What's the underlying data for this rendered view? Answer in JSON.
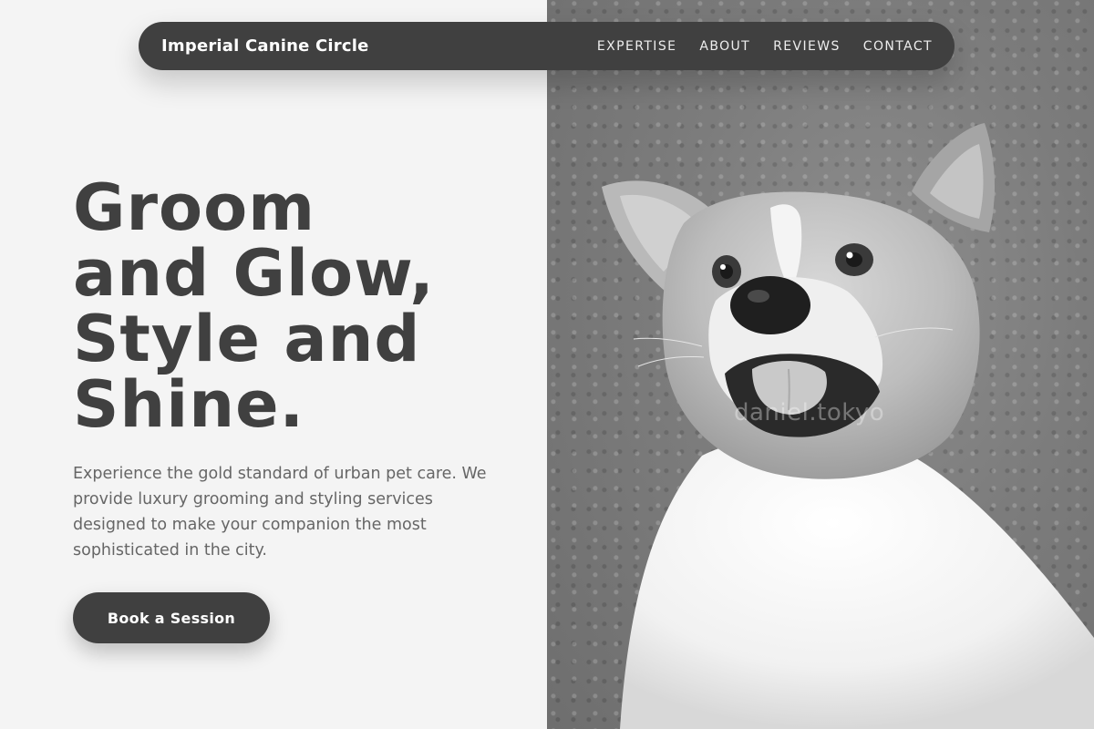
{
  "brand": {
    "name": "Imperial Canine Circle"
  },
  "nav": {
    "items": [
      {
        "label": "EXPERTISE"
      },
      {
        "label": "ABOUT"
      },
      {
        "label": "REVIEWS"
      },
      {
        "label": "CONTACT"
      }
    ]
  },
  "hero": {
    "headline_lines": [
      "Groom",
      "and Glow,",
      "Style and",
      "Shine."
    ],
    "intro": "Experience the gold standard of urban pet care. We provide luxury grooming and styling services designed to make your companion the most sophisticated in the city.",
    "cta_label": "Book a Session"
  },
  "photo": {
    "watermark": "daniel.tokyo",
    "icon": "corgi-photo",
    "style": "black-and-white"
  },
  "colors": {
    "primary_dark": "#404040",
    "background": "#f4f4f4",
    "body_text": "#666666",
    "nav_text": "#ffffff"
  }
}
